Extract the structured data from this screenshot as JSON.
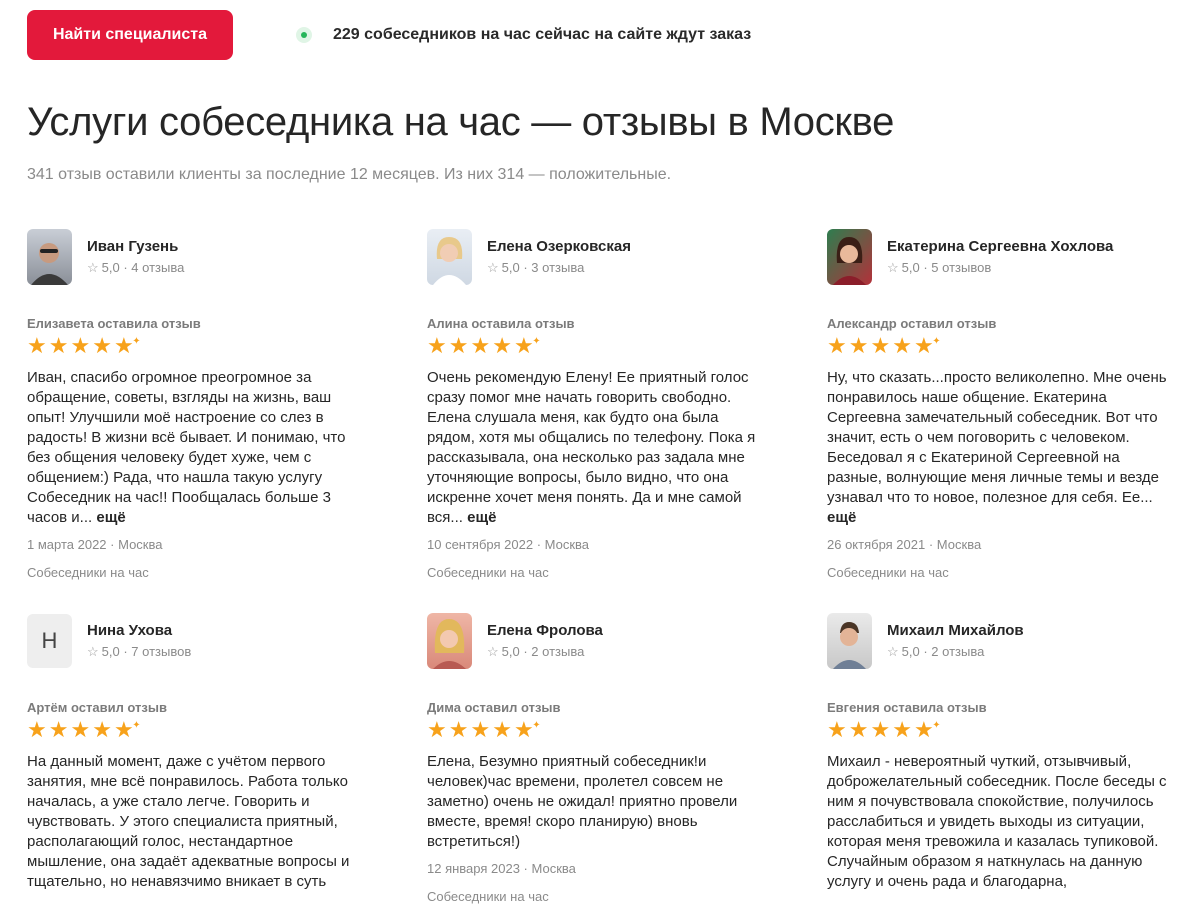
{
  "header": {
    "find_button": "Найти специалиста",
    "online_text": "229 собеседников на час сейчас на сайте ждут заказ"
  },
  "title": "Услуги собеседника на час — отзывы в Москве",
  "subtitle": "341 отзыв оставили клиенты за последние 12 месяцев. Из них 314 — положительные.",
  "colors": {
    "accent": "#e3193b",
    "star": "#f7a21b",
    "online": "#26b55a"
  },
  "reviews": [
    {
      "specialist": "Иван Гузень",
      "rating": "5,0",
      "review_count": "4 отзыва",
      "avatar": "photo",
      "author_line": "Елизавета оставила отзыв",
      "stars": 4.5,
      "text": "Иван, спасибо огромное преогромное за обращение, советы, взгляды на жизнь, ваш опыт! Улучшили моё настроение со слез в радость! В жизни всё бывает. И понимаю, что без общения человеку будет хуже, чем с общением:) Рада, что нашла такую услугу Собеседник на час!! Пообщалась больше 3 часов и...",
      "more": "ещё",
      "date": "1 марта 2022",
      "city": "Москва",
      "service": "Собеседники на час"
    },
    {
      "specialist": "Елена Озерковская",
      "rating": "5,0",
      "review_count": "3 отзыва",
      "avatar": "photo",
      "author_line": "Алина оставила отзыв",
      "stars": 4.5,
      "text": "Очень рекомендую Елену! Ее приятный голос сразу помог мне начать говорить свободно. Елена слушала меня, как будто она была рядом, хотя мы общались по телефону. Пока я рассказывала, она несколько раз задала мне уточняющие вопросы, было видно, что она искренне хочет меня понять. Да и мне самой вся...",
      "more": "ещё",
      "date": "10 сентября 2022",
      "city": "Москва",
      "service": "Собеседники на час"
    },
    {
      "specialist": "Екатерина Сергеевна Хохлова",
      "rating": "5,0",
      "review_count": "5 отзывов",
      "avatar": "photo",
      "author_line": "Александр оставил отзыв",
      "stars": 4.5,
      "text": "Ну, что сказать...просто великолепно. Мне очень понравилось наше общение. Екатерина Сергеевна замечательный собеседник. Вот что значит, есть о чем поговорить с человеком. Беседовал я с Екатериной Сергеевной на разные, волнующие меня личные темы и везде узнавал что то новое, полезное для себя. Ее...",
      "more": "ещё",
      "date": "26 октября 2021",
      "city": "Москва",
      "service": "Собеседники на час"
    },
    {
      "specialist": "Нина Ухова",
      "rating": "5,0",
      "review_count": "7 отзывов",
      "avatar": "letter",
      "avatar_letter": "Н",
      "author_line": "Артём оставил отзыв",
      "stars": 4.5,
      "text": "На данный момент, даже с учётом первого занятия, мне всё понравилось. Работа только началась, а уже стало легче. Говорить и чувствовать. У этого специалиста приятный, располагающий голос, нестандартное мышление, она задаёт адекватные вопросы и тщательно, но ненавязчимо вникает в суть",
      "more": "",
      "date": "",
      "city": "",
      "service": ""
    },
    {
      "specialist": "Елена Фролова",
      "rating": "5,0",
      "review_count": "2 отзыва",
      "avatar": "photo",
      "author_line": "Дима оставил отзыв",
      "stars": 4.5,
      "text": "Елена, Безумно приятный собеседник!и человек)час времени, пролетел совсем не заметно) очень не ожидал! приятно провели вместе, время! скоро планирую) вновь встретиться!)",
      "more": "",
      "date": "12 января 2023",
      "city": "Москва",
      "service": "Собеседники на час"
    },
    {
      "specialist": "Михаил Михайлов",
      "rating": "5,0",
      "review_count": "2 отзыва",
      "avatar": "photo",
      "author_line": "Евгения оставила отзыв",
      "stars": 4.5,
      "text": "Михаил - невероятный чуткий, отзывчивый, доброжелательный собеседник. После беседы с ним я почувствовала спокойствие, получилось расслабиться и увидеть выходы из ситуации, которая меня тревожила и казалась тупиковой. Случайным образом я наткнулась на данную услугу и очень рада и благодарна,",
      "more": "",
      "date": "",
      "city": "",
      "service": ""
    }
  ]
}
